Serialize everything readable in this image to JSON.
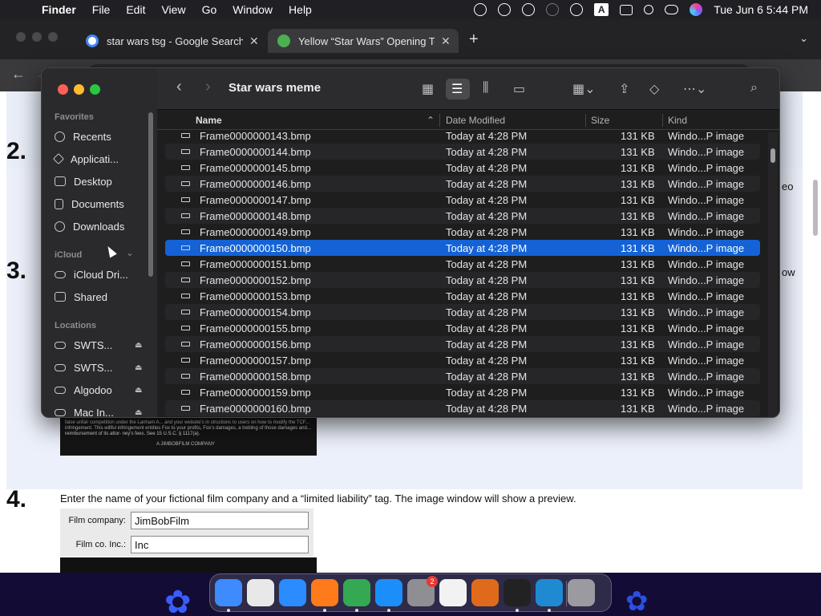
{
  "menubar": {
    "app": "Finder",
    "items": [
      "File",
      "Edit",
      "View",
      "Go",
      "Window",
      "Help"
    ],
    "input_source": "A",
    "clock": "Tue Jun 6  5:44 PM"
  },
  "browser": {
    "tabs": [
      {
        "title": "star wars tsg - Google Search",
        "favicon_color": "#4285f4"
      },
      {
        "title": "Yellow “Star Wars” Opening Te",
        "favicon_color": "#4caf50"
      }
    ],
    "url": "",
    "page": {
      "step2": "2.",
      "step3": "3.",
      "step4": "4.",
      "step4_text": "Enter the name of your fictional film company and a “limited liability” tag. The image window will show a preview.",
      "fragment_right_1": "eo",
      "fragment_right_2": "ow",
      "preview_text": "false unfair competition under the Lanham A... and your website's in structions to users on how to modify the TCF... infringement. This willful infringement entitles Fox to your profits, Fox's damages, a trebling of those damages and... reimbursement of its attor- ney's fees. See 15 U.S.C. § 1117(a).",
      "preview_credit": "A JIMBOBFILM COMPANY",
      "form": {
        "company_label": "Film company:",
        "company_value": "JimBobFilm",
        "inc_label": "Film co. Inc.:",
        "inc_value": "Inc"
      }
    }
  },
  "finder": {
    "title": "Star wars meme",
    "sidebar": {
      "favorites_header": "Favorites",
      "favorites": [
        "Recents",
        "Applicati...",
        "Desktop",
        "Documents",
        "Downloads"
      ],
      "icloud_header": "iCloud",
      "icloud": [
        "iCloud Dri...",
        "Shared"
      ],
      "locations_header": "Locations",
      "locations": [
        "SWTS...",
        "SWTS...",
        "Algodoo",
        "Mac In..."
      ]
    },
    "columns": {
      "name": "Name",
      "date": "Date Modified",
      "size": "Size",
      "kind": "Kind"
    },
    "rows": [
      {
        "name": "Frame0000000143.bmp",
        "date": "Today at 4:28 PM",
        "size": "131 KB",
        "kind": "Windo...P image"
      },
      {
        "name": "Frame0000000144.bmp",
        "date": "Today at 4:28 PM",
        "size": "131 KB",
        "kind": "Windo...P image"
      },
      {
        "name": "Frame0000000145.bmp",
        "date": "Today at 4:28 PM",
        "size": "131 KB",
        "kind": "Windo...P image"
      },
      {
        "name": "Frame0000000146.bmp",
        "date": "Today at 4:28 PM",
        "size": "131 KB",
        "kind": "Windo...P image"
      },
      {
        "name": "Frame0000000147.bmp",
        "date": "Today at 4:28 PM",
        "size": "131 KB",
        "kind": "Windo...P image"
      },
      {
        "name": "Frame0000000148.bmp",
        "date": "Today at 4:28 PM",
        "size": "131 KB",
        "kind": "Windo...P image"
      },
      {
        "name": "Frame0000000149.bmp",
        "date": "Today at 4:28 PM",
        "size": "131 KB",
        "kind": "Windo...P image"
      },
      {
        "name": "Frame0000000150.bmp",
        "date": "Today at 4:28 PM",
        "size": "131 KB",
        "kind": "Windo...P image",
        "selected": true
      },
      {
        "name": "Frame0000000151.bmp",
        "date": "Today at 4:28 PM",
        "size": "131 KB",
        "kind": "Windo...P image"
      },
      {
        "name": "Frame0000000152.bmp",
        "date": "Today at 4:28 PM",
        "size": "131 KB",
        "kind": "Windo...P image"
      },
      {
        "name": "Frame0000000153.bmp",
        "date": "Today at 4:28 PM",
        "size": "131 KB",
        "kind": "Windo...P image"
      },
      {
        "name": "Frame0000000154.bmp",
        "date": "Today at 4:28 PM",
        "size": "131 KB",
        "kind": "Windo...P image"
      },
      {
        "name": "Frame0000000155.bmp",
        "date": "Today at 4:28 PM",
        "size": "131 KB",
        "kind": "Windo...P image"
      },
      {
        "name": "Frame0000000156.bmp",
        "date": "Today at 4:28 PM",
        "size": "131 KB",
        "kind": "Windo...P image"
      },
      {
        "name": "Frame0000000157.bmp",
        "date": "Today at 4:28 PM",
        "size": "131 KB",
        "kind": "Windo...P image"
      },
      {
        "name": "Frame0000000158.bmp",
        "date": "Today at 4:28 PM",
        "size": "131 KB",
        "kind": "Windo...P image"
      },
      {
        "name": "Frame0000000159.bmp",
        "date": "Today at 4:28 PM",
        "size": "131 KB",
        "kind": "Windo...P image"
      },
      {
        "name": "Frame0000000160.bmp",
        "date": "Today at 4:28 PM",
        "size": "131 KB",
        "kind": "Windo...P image"
      }
    ]
  },
  "dock": {
    "apps": [
      {
        "name": "finder-icon",
        "color": "#3d8bfd"
      },
      {
        "name": "launchpad-icon",
        "color": "#e8e8e8"
      },
      {
        "name": "safari-icon",
        "color": "#2b8cff"
      },
      {
        "name": "firefox-icon",
        "color": "#ff7a1a"
      },
      {
        "name": "chrome-icon",
        "color": "#34a853"
      },
      {
        "name": "app-store-icon",
        "color": "#1c8ef9"
      },
      {
        "name": "system-settings-icon",
        "color": "#8e8e93"
      },
      {
        "name": "textedit-icon",
        "color": "#f2f2f2"
      },
      {
        "name": "garageband-icon",
        "color": "#e06a1b"
      },
      {
        "name": "terminal-icon",
        "color": "#222222"
      },
      {
        "name": "vscode-icon",
        "color": "#1f8ad2"
      },
      {
        "name": "trash-icon",
        "color": "#9a9aa0"
      }
    ],
    "settings_badge": "2"
  }
}
